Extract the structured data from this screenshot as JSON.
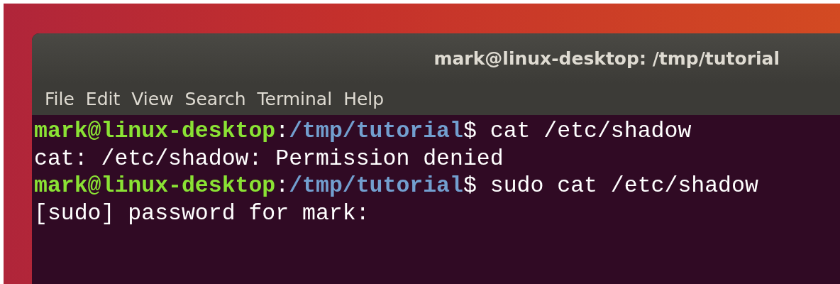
{
  "window": {
    "title": "mark@linux-desktop: /tmp/tutorial"
  },
  "menu": [
    "File",
    "Edit",
    "View",
    "Search",
    "Terminal",
    "Help"
  ],
  "lines": [
    {
      "kind": "prompt",
      "user_host": "mark@linux-desktop",
      "separator": ":",
      "path": "/tmp/tutorial",
      "symbol": "$",
      "command": "cat /etc/shadow"
    },
    {
      "kind": "output",
      "text": "cat: /etc/shadow: Permission denied"
    },
    {
      "kind": "prompt",
      "user_host": "mark@linux-desktop",
      "separator": ":",
      "path": "/tmp/tutorial",
      "symbol": "$",
      "command": "sudo cat /etc/shadow"
    },
    {
      "kind": "output",
      "text": "[sudo] password for mark:"
    }
  ]
}
